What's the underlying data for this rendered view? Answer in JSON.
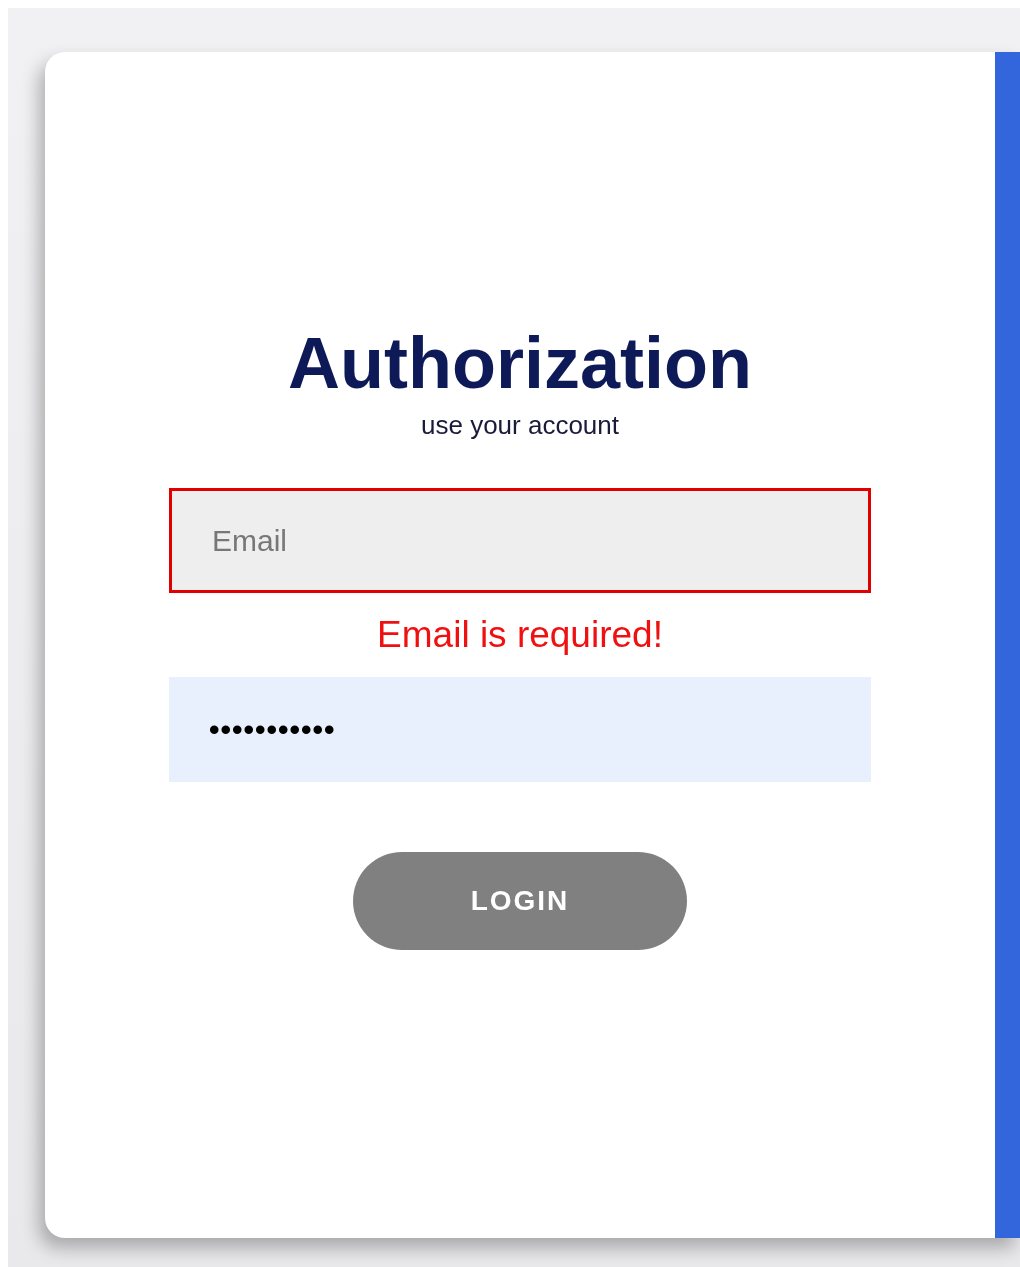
{
  "title": "Authorization",
  "subtitle": "use your account",
  "email": {
    "placeholder": "Email",
    "invalid": true,
    "error": "Email is required!"
  },
  "password": {
    "value": "•••••••••••"
  },
  "login_button": {
    "label": "LOGIN",
    "disabled": true
  }
}
